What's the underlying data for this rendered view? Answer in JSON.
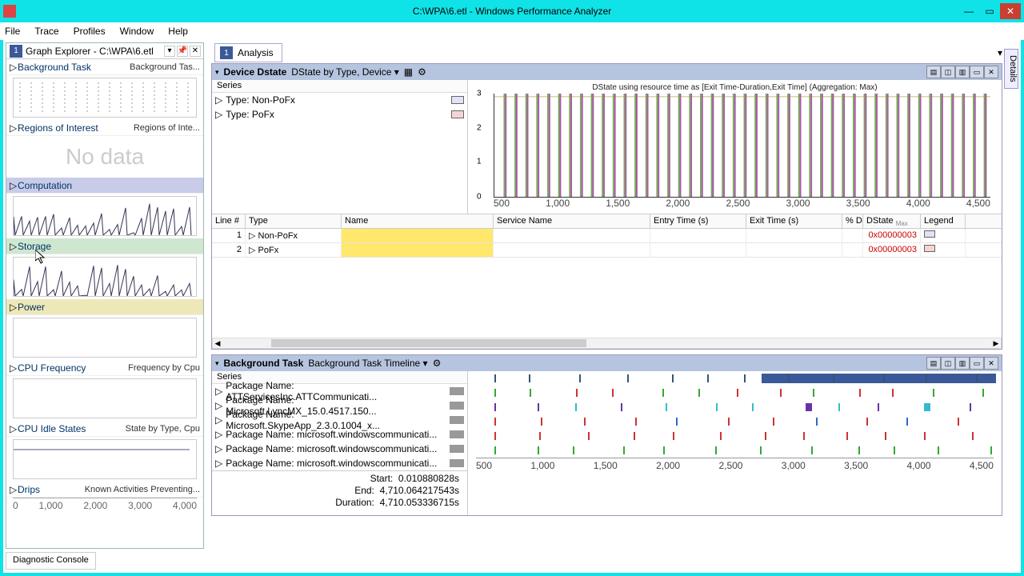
{
  "window": {
    "title": "C:\\WPA\\6.etl - Windows Performance Analyzer"
  },
  "menu": [
    "File",
    "Trace",
    "Profiles",
    "Window",
    "Help"
  ],
  "graph_explorer": {
    "title": "Graph Explorer - C:\\WPA\\6.etl",
    "badge": "1",
    "sections": [
      {
        "title": "Background Task",
        "sub": "Background Tas...",
        "graph": "ticks"
      },
      {
        "title": "Regions of Interest",
        "sub": "Regions of Inte...",
        "graph": "nodata",
        "nodata": "No data"
      },
      {
        "title": "Computation",
        "sub": "",
        "class": "compute",
        "graph": "spiky"
      },
      {
        "title": "Storage",
        "sub": "",
        "class": "storage",
        "graph": "spiky2"
      },
      {
        "title": "Power",
        "sub": "",
        "class": "power",
        "graph": "blank"
      },
      {
        "title": "CPU Frequency",
        "sub": "Frequency by Cpu",
        "graph": "blank"
      },
      {
        "title": "CPU Idle States",
        "sub": "State by Type, Cpu",
        "graph": "flat"
      },
      {
        "title": "Drips",
        "sub": "Known Activities Preventing...",
        "graph": "none"
      }
    ],
    "ruler": [
      "0",
      "1,000",
      "2,000",
      "3,000",
      "4,000"
    ]
  },
  "analysis": {
    "tab_badge": "1",
    "tab_label": "Analysis"
  },
  "details_tab": "Details",
  "device_panel": {
    "title": "Device Dstate",
    "preset": "DState by Type, Device",
    "series_hdr": "Series",
    "series": [
      {
        "label": "Type: Non-PoFx",
        "color": "#dfe3f5"
      },
      {
        "label": "Type: PoFx",
        "color": "#f6d4d4"
      }
    ],
    "chart_caption": "DState using resource time as [Exit Time-Duration,Exit Time] (Aggregation: Max)",
    "xaxis": [
      "500",
      "1,000",
      "1,500",
      "2,000",
      "2,500",
      "3,000",
      "3,500",
      "4,000",
      "4,500"
    ],
    "columns": [
      "Line #",
      "Type",
      "Name",
      "Service Name",
      "Entry Time (s)",
      "Exit Time (s)",
      "% D",
      "DState",
      "Legend"
    ],
    "col_max": "Max",
    "rows": [
      {
        "line": "1",
        "type": "Non-PoFx",
        "dstate": "0x00000003",
        "sw": "#dfe3f5"
      },
      {
        "line": "2",
        "type": "PoFx",
        "dstate": "0x00000003",
        "sw": "#f6d4d4"
      }
    ]
  },
  "bgtask_panel": {
    "title": "Background Task",
    "preset": "Background Task Timeline",
    "series_hdr": "Series",
    "packages": [
      "Package Name: ATTServicesInc.ATTCommunicati...",
      "Package Name: Microsoft.LyncMX_15.0.4517.150...",
      "Package Name: Microsoft.SkypeApp_2.3.0.1004_x...",
      "Package Name: microsoft.windowscommunicati...",
      "Package Name: microsoft.windowscommunicati...",
      "Package Name: microsoft.windowscommunicati..."
    ],
    "xaxis": [
      "500",
      "1,000",
      "1,500",
      "2,000",
      "2,500",
      "3,000",
      "3,500",
      "4,000",
      "4,500"
    ],
    "stats": {
      "start_label": "Start:",
      "start": "0.010880828s",
      "end_label": "End:",
      "end": "4,710.064217543s",
      "dur_label": "Duration:",
      "dur": "4,710.053336715s"
    }
  },
  "statusbar": "Diagnostic Console",
  "chart_data": [
    {
      "type": "line",
      "title": "DState using resource time as [Exit Time-Duration,Exit Time] (Aggregation: Max)",
      "ylabel": "",
      "xlabel": "",
      "ylim": [
        0,
        3
      ],
      "x": [
        0,
        500,
        1000,
        1500,
        2000,
        2500,
        3000,
        3500,
        4000,
        4500
      ],
      "series": [
        {
          "name": "Non-PoFx",
          "values": [
            3,
            3,
            3,
            3,
            3,
            3,
            3,
            3,
            3,
            3
          ]
        },
        {
          "name": "PoFx",
          "values": [
            3,
            3,
            3,
            3,
            3,
            3,
            3,
            3,
            3,
            3
          ]
        }
      ],
      "note": "Many brief dips to 0 throughout (spike pattern)"
    },
    {
      "type": "timeline",
      "title": "Background Task Timeline",
      "x_range": [
        0,
        4710
      ],
      "series": [
        {
          "name": "ATTServicesInc.ATTCommunicati",
          "events": "sparse vertical ticks + filled bar ~3000-4700"
        },
        {
          "name": "Microsoft.LyncMX",
          "events": "regular red/green ticks across range"
        },
        {
          "name": "Microsoft.SkypeApp",
          "events": "purple/teal block markers"
        },
        {
          "name": "microsoft.windowscommunicati 1",
          "events": "regular red/blue ticks"
        },
        {
          "name": "microsoft.windowscommunicati 2",
          "events": "dense red ticks"
        },
        {
          "name": "microsoft.windowscommunicati 3",
          "events": "regular green ticks"
        }
      ]
    }
  ]
}
